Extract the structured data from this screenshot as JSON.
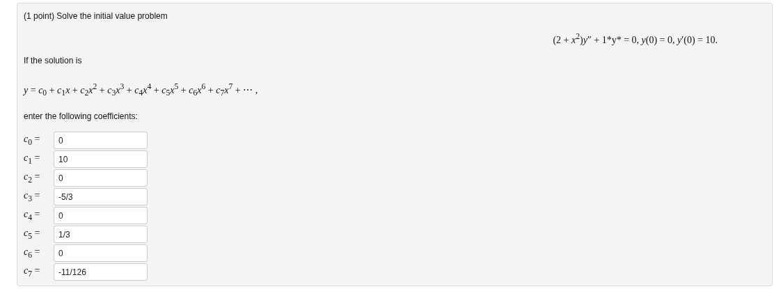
{
  "problem": {
    "title": "(1 point) Solve the initial value problem",
    "equation": "(2 + *x*$^{2}$)*y*″ + 1*y* = 0, *y*(0) = 0, *y*′(0) = 10.",
    "lead": "If the solution is",
    "series": "*y* = *c*$_{0}$ + *c*$_{1}$*x* + *c*$_{2}$*x*$^{2}$ + *c*$_{3}$*x*$^{3}$ + *c*$_{4}$*x*$^{4}$ + *c*$_{5}$*x*$^{5}$ + *c*$_{6}$*x*$^{6}$ + *c*$_{7}$*x*$^{7}$ + ⋯ ,",
    "prompt": "enter the following coefficients:",
    "answers": [
      {
        "label": "*c*$_{0}$ =",
        "value": "0"
      },
      {
        "label": "*c*$_{1}$ =",
        "value": "10"
      },
      {
        "label": "*c*$_{2}$ =",
        "value": "0"
      },
      {
        "label": "*c*$_{3}$ =",
        "value": "-5/3"
      },
      {
        "label": "*c*$_{4}$ =",
        "value": "0"
      },
      {
        "label": "*c*$_{5}$ =",
        "value": "1/3"
      },
      {
        "label": "*c*$_{6}$ =",
        "value": "0"
      },
      {
        "label": "*c*$_{7}$ =",
        "value": "-11/126"
      }
    ]
  }
}
